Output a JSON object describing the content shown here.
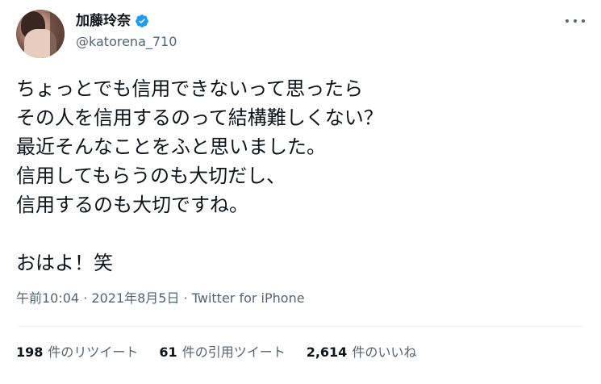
{
  "author": {
    "display_name": "加藤玲奈",
    "handle": "@katorena_710",
    "verified": true
  },
  "tweet": {
    "lines": [
      "ちょっとでも信用できないって思ったら",
      "その人を信用するのって結構難しくない？",
      "最近そんなことをふと思いました。",
      "信用してもらうのも大切だし、",
      "信用するのも大切ですね。",
      "",
      "おはよ！笑"
    ]
  },
  "meta": {
    "time": "午前10:04",
    "separator": " · ",
    "date": "2021年8月5日",
    "source": "Twitter for iPhone"
  },
  "stats": {
    "retweets_count": "198",
    "retweets_label": "件のリツイート",
    "quotes_count": "61",
    "quotes_label": "件の引用ツイート",
    "likes_count": "2,614",
    "likes_label": "件のいいね"
  },
  "colors": {
    "text": "#0f1419",
    "secondary": "#536471",
    "verified": "#1d9bf0",
    "divider": "#eff3f4"
  }
}
